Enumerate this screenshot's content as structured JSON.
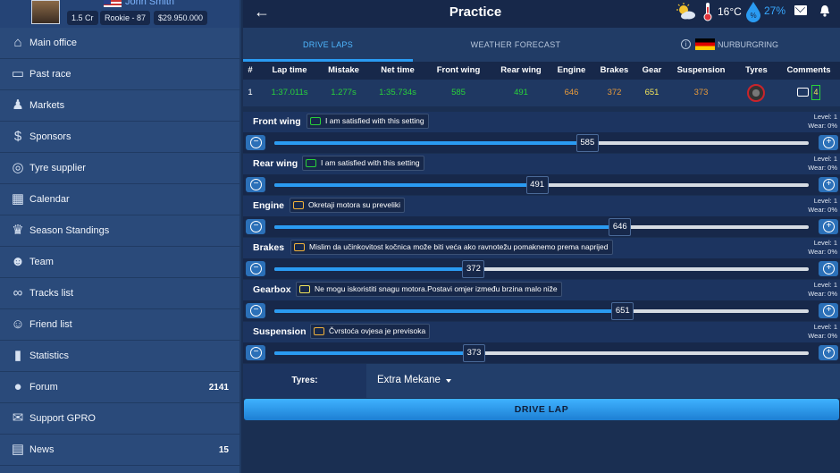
{
  "profile": {
    "name": "John Smith",
    "cash_badge": "1.5 Cr",
    "level_badge": "Rookie - 87",
    "money_badge": "$29.950.000"
  },
  "sidebar": {
    "items": [
      {
        "label": "Main office",
        "icon": "home-icon"
      },
      {
        "label": "Past race",
        "icon": "past-race-icon"
      },
      {
        "label": "Markets",
        "icon": "markets-icon"
      },
      {
        "label": "Sponsors",
        "icon": "dollar-icon"
      },
      {
        "label": "Tyre supplier",
        "icon": "tyre-icon"
      },
      {
        "label": "Calendar",
        "icon": "calendar-icon"
      },
      {
        "label": "Season Standings",
        "icon": "trophy-icon"
      },
      {
        "label": "Team",
        "icon": "team-icon"
      },
      {
        "label": "Tracks list",
        "icon": "track-icon"
      },
      {
        "label": "Friend list",
        "icon": "friends-icon"
      },
      {
        "label": "Statistics",
        "icon": "statistics-icon"
      },
      {
        "label": "Forum",
        "icon": "forum-icon",
        "count": "2141"
      },
      {
        "label": "Support GPRO",
        "icon": "support-icon"
      },
      {
        "label": "News",
        "icon": "news-icon",
        "count": "15"
      }
    ]
  },
  "topbar": {
    "title": "Practice",
    "temperature": "16°C",
    "humidity": "27%"
  },
  "tabs": {
    "drive_laps": "DRIVE LAPS",
    "weather_forecast": "WEATHER FORECAST",
    "track": "NURBURGRING"
  },
  "table": {
    "headers": [
      "#",
      "Lap time",
      "Mistake",
      "Net time",
      "Front wing",
      "Rear wing",
      "Engine",
      "Brakes",
      "Gear",
      "Suspension",
      "Tyres",
      "Comments"
    ],
    "row": {
      "num": "1",
      "lap_time": "1:37.011s",
      "mistake": "1.277s",
      "net_time": "1:35.734s",
      "front_wing": "585",
      "rear_wing": "491",
      "engine": "646",
      "brakes": "372",
      "gear": "651",
      "suspension": "373",
      "comment_count": "4"
    }
  },
  "settings": [
    {
      "name": "Front wing",
      "comment": "I am satisfied with this setting",
      "level": "Level: 1",
      "wear": "Wear: 0%",
      "value": 585,
      "fraction": 0.585
    },
    {
      "name": "Rear wing",
      "comment": "I am satisfied with this setting",
      "level": "Level: 1",
      "wear": "Wear: 0%",
      "value": 491,
      "fraction": 0.491
    },
    {
      "name": "Engine",
      "comment": "Okretaji motora su preveliki",
      "level": "Level: 1",
      "wear": "Wear: 0%",
      "value": 646,
      "fraction": 0.646
    },
    {
      "name": "Brakes",
      "comment": "Mislim da učinkovitost kočnica može biti veća ako ravnotežu pomaknemo prema naprijed",
      "level": "Level: 1",
      "wear": "Wear: 0%",
      "value": 372,
      "fraction": 0.372
    },
    {
      "name": "Gearbox",
      "comment": "Ne mogu iskoristiti snagu motora.Postavi omjer između brzina malo niže",
      "level": "Level: 1",
      "wear": "Wear: 0%",
      "value": 651,
      "fraction": 0.651
    },
    {
      "name": "Suspension",
      "comment": "Čvrstoća ovjesa je previsoka",
      "level": "Level: 1",
      "wear": "Wear: 0%",
      "value": 373,
      "fraction": 0.373
    }
  ],
  "tyres": {
    "label": "Tyres:",
    "value": "Extra Mekane"
  },
  "drive_button": "DRIVE LAP"
}
